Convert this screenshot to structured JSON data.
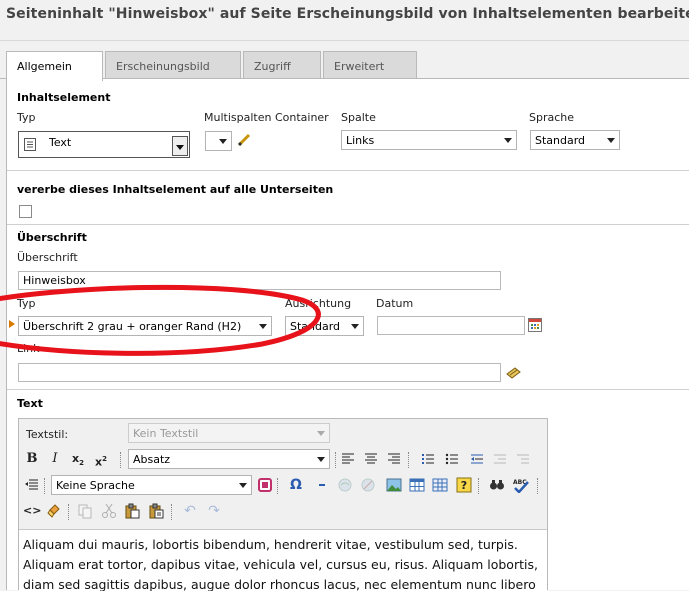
{
  "page": {
    "title": "Seiteninhalt \"Hinweisbox\" auf Seite Erscheinungsbild von Inhaltselementen bearbeiten"
  },
  "tabs": [
    {
      "label": "Allgemein",
      "active": true
    },
    {
      "label": "Erscheinungsbild",
      "active": false
    },
    {
      "label": "Zugriff",
      "active": false
    },
    {
      "label": "Erweitert",
      "active": false
    }
  ],
  "content_element": {
    "section_title": "Inhaltselement",
    "type_label": "Typ",
    "type_value": "Text",
    "multicol_label": "Multispalten Container",
    "multicol_value": "",
    "column_label": "Spalte",
    "column_value": "Links",
    "language_label": "Sprache",
    "language_value": "Standard"
  },
  "inherit": {
    "label": "vererbe dieses Inhaltselement auf alle Unterseiten",
    "checked": false
  },
  "heading": {
    "section_title": "Überschrift",
    "field_label": "Überschrift",
    "field_value": "Hinweisbox",
    "type_label": "Typ",
    "type_value": "Überschrift 2 grau + oranger Rand (H2)",
    "align_label": "Ausrichtung",
    "align_value": "Standard",
    "date_label": "Datum",
    "date_value": "",
    "link_label": "Link",
    "link_value": ""
  },
  "text": {
    "section_title": "Text",
    "textstyle_label": "Textstil:",
    "textstyle_value": "Kein Textstil",
    "block_value": "Absatz",
    "language_value": "Keine Sprache",
    "body_lines": [
      "Aliquam dui mauris, lobortis bibendum, hendrerit vitae, vestibulum sed, turpis.",
      "Aliquam erat tortor, dapibus vitae, vehicula vel, cursus eu, risus. Aliquam lobortis,",
      "diam sed sagittis dapibus, augue dolor rhoncus lacus, nec elementum nunc libero"
    ]
  },
  "colors": {
    "annotation_red": "#e8121b",
    "tab_active_bg": "#ffffff",
    "tab_inactive_bg": "#dadada"
  }
}
